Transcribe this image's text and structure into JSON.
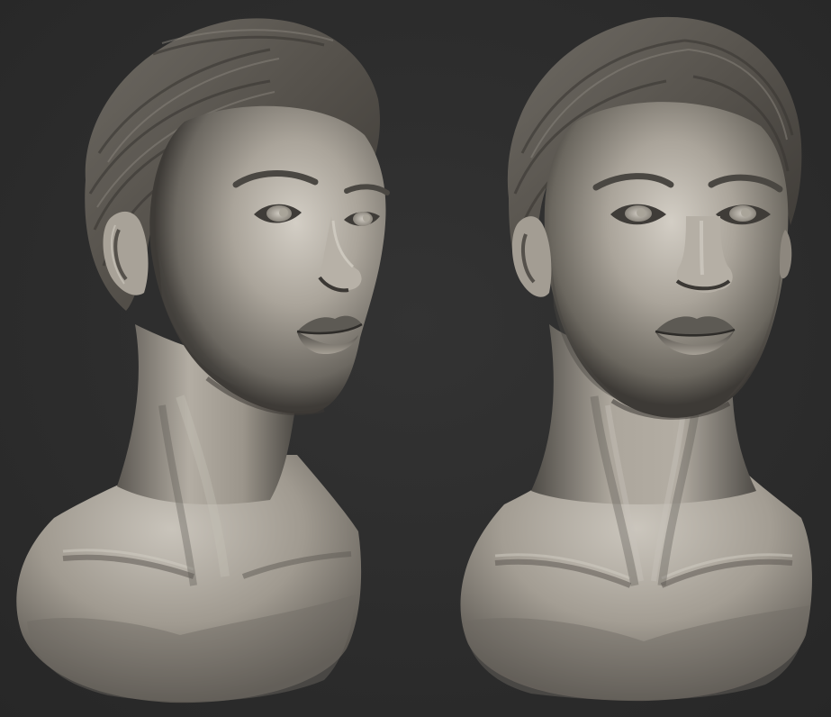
{
  "viewport": {
    "background_color": "#2c2c2c",
    "material_color": "#a8a298",
    "material_shadow_color": "#4a4742",
    "material_highlight_color": "#d6d1c8"
  },
  "subjects": [
    {
      "name": "female-head-bust-three-quarter-view",
      "view": "three-quarter"
    },
    {
      "name": "female-head-bust-front-view",
      "view": "front"
    }
  ]
}
